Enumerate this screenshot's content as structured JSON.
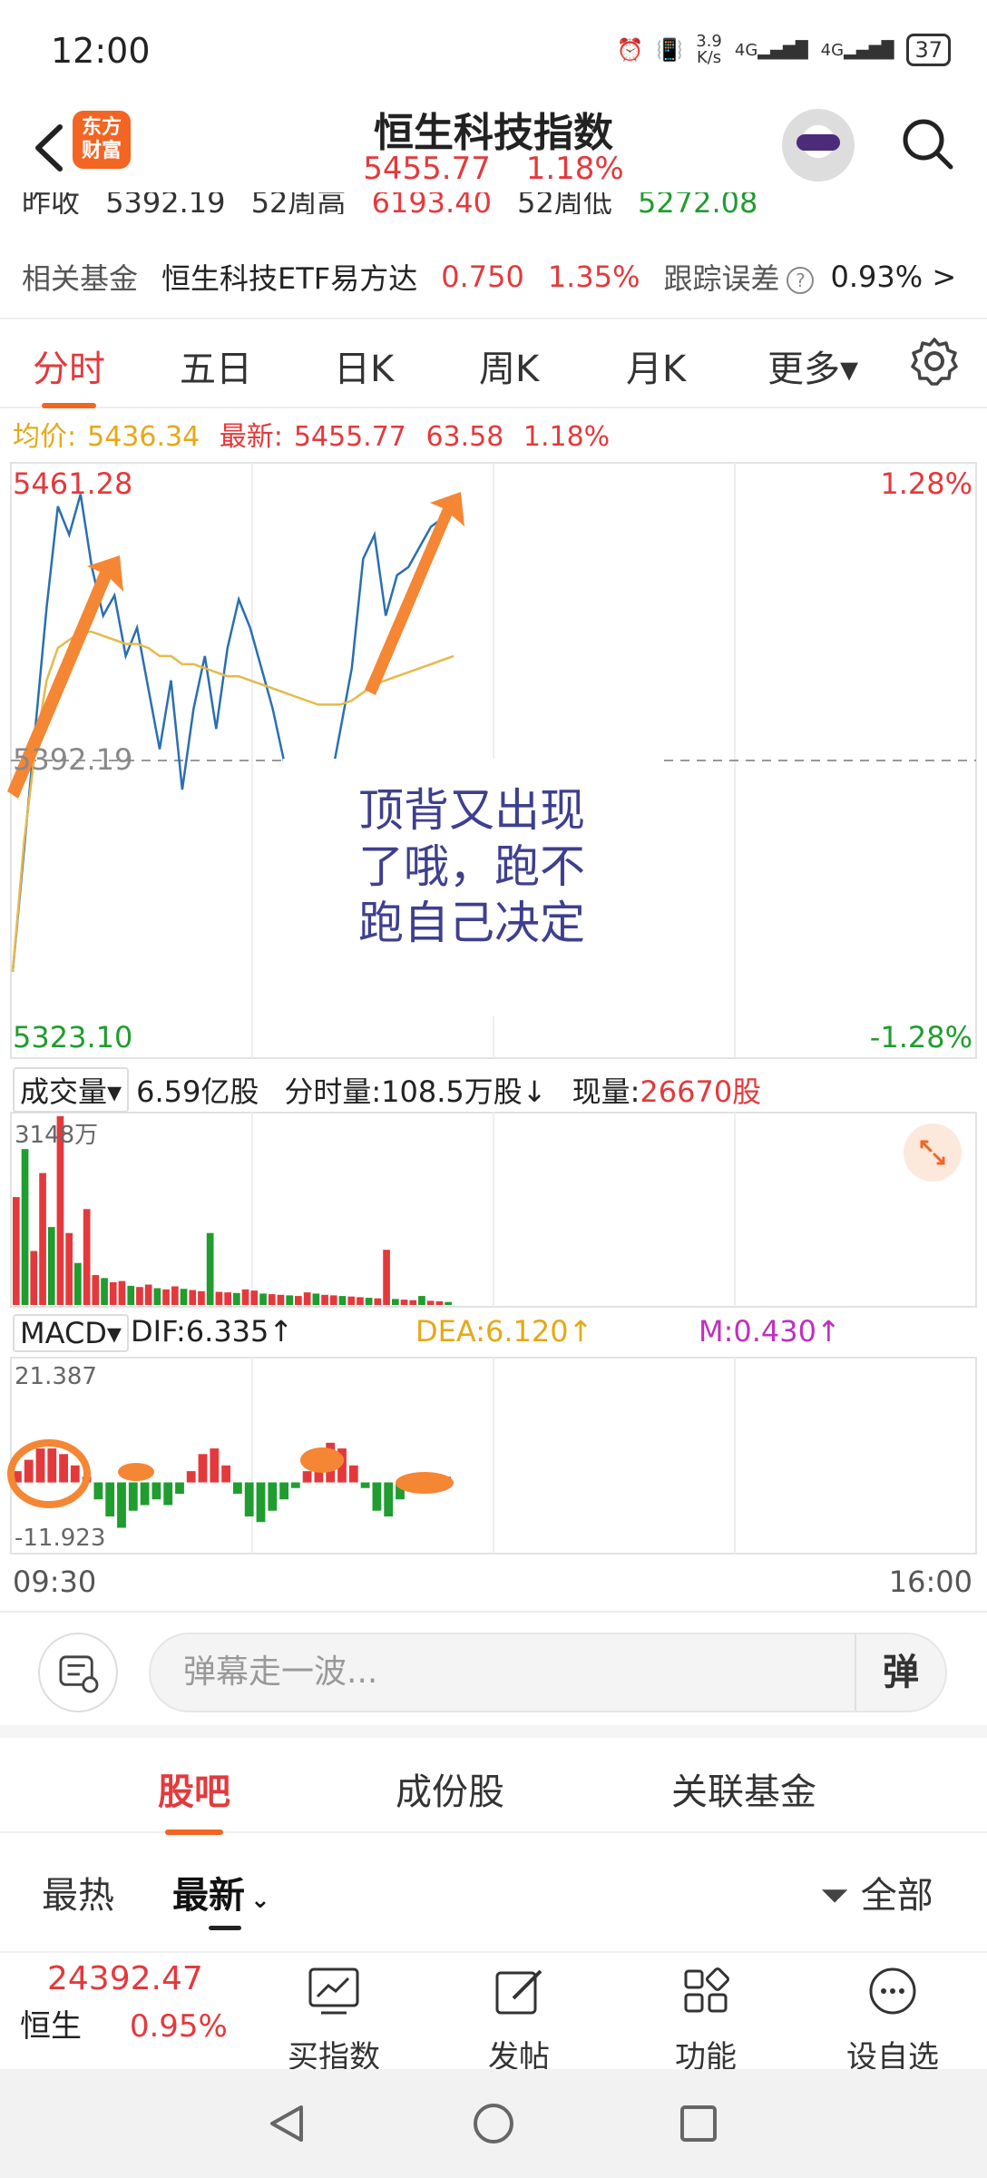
{
  "status_bar": {
    "time": "12:00",
    "net_speed": "3.9\nK/s",
    "net_speed_top": "3.9",
    "net_speed_bottom": "K/s",
    "signal1": "4G",
    "signal2": "4G",
    "battery": "37"
  },
  "header": {
    "logo_line1": "东方",
    "logo_line2": "财富",
    "title": "恒生科技指数",
    "price": "5455.77",
    "change_pct": "1.18%"
  },
  "clipped_row": {
    "prev_close_label": "昨收",
    "prev_close": "5392.19",
    "high52_label": "52周高",
    "high52": "6193.40",
    "low52_label": "52周低",
    "low52": "5272.08"
  },
  "fund_row": {
    "label": "相关基金",
    "fund_name": "恒生科技ETF易方达",
    "fund_price": "0.750",
    "fund_pct": "1.35%",
    "tracking_label": "跟踪误差",
    "tracking_value": "0.93%",
    "arrow": ">"
  },
  "tabs": [
    {
      "label": "分时"
    },
    {
      "label": "五日"
    },
    {
      "label": "日K"
    },
    {
      "label": "周K"
    },
    {
      "label": "月K"
    },
    {
      "label": "更多▾"
    }
  ],
  "avg_row": {
    "avg_label": "均价:",
    "avg_value": "5436.34",
    "latest_label": "最新:",
    "latest_value": "5455.77",
    "change": "63.58",
    "change_pct": "1.18%"
  },
  "chart_axis": {
    "top_price": "5461.28",
    "top_pct": "1.28%",
    "mid_price": "5392.19",
    "bottom_price": "5323.10",
    "bottom_pct": "-1.28%"
  },
  "annotation": {
    "line1": "顶背又出现",
    "line2": "了哦，跑不",
    "line3": "跑自己决定"
  },
  "volume_row": {
    "dropdown": "成交量▾",
    "total": "6.59亿股",
    "minute_label": "分时量:",
    "minute_value": "108.5万股↓",
    "now_label": "现量:",
    "now_value": "26670股",
    "max_label": "3148万"
  },
  "macd_row": {
    "dropdown": "MACD▾",
    "dif": "DIF:6.335↑",
    "dea": "DEA:6.120↑",
    "m": "M:0.430↑",
    "top": "21.387",
    "bottom": "-11.923"
  },
  "time_axis": {
    "start": "09:30",
    "end": "16:00"
  },
  "comment_bar": {
    "placeholder": "弹幕走一波...",
    "send": "弹"
  },
  "forum_tabs": [
    {
      "label": "股吧"
    },
    {
      "label": "成份股"
    },
    {
      "label": "关联基金"
    }
  ],
  "sort_row": {
    "hot": "最热",
    "latest": "最新",
    "filter": "全部"
  },
  "bottom_nav": {
    "index_value": "24392.47",
    "index_name": "恒生",
    "index_pct": "0.95%",
    "items": [
      {
        "label": "买指数"
      },
      {
        "label": "发帖"
      },
      {
        "label": "功能"
      },
      {
        "label": "设自选"
      }
    ]
  },
  "chart_data": [
    {
      "type": "line",
      "title": "",
      "xlabel": "",
      "ylabel": "",
      "x_range": [
        "09:30",
        "16:00"
      ],
      "ylim": [
        5323.1,
        5461.28
      ],
      "reference_line": 5392.19,
      "series": [
        {
          "values": [
            5340,
            5370,
            5400,
            5430,
            5455,
            5448,
            5458,
            5440,
            5428,
            5433,
            5418,
            5425,
            5410,
            5395,
            5412,
            5385,
            5405,
            5418,
            5400,
            5420,
            5432,
            5425,
            5415,
            5405,
            5392,
            5385,
            5380,
            5370,
            5385,
            5400,
            5415,
            5442,
            5448,
            5428,
            5438,
            5440,
            5445,
            5450,
            5452,
            5455
          ]
        },
        {
          "values": [
            5340,
            5372,
            5395,
            5412,
            5420,
            5422,
            5424,
            5424,
            5423,
            5422,
            5421,
            5421,
            5420,
            5418,
            5418,
            5416,
            5416,
            5415,
            5414,
            5413,
            5413,
            5412,
            5411,
            5410,
            5409,
            5408,
            5407,
            5406,
            5406,
            5406,
            5407,
            5409,
            5411,
            5412,
            5413,
            5414,
            5415,
            5416,
            5417,
            5418
          ]
        }
      ]
    },
    {
      "type": "bar",
      "title": "",
      "ylim": [
        0,
        3148
      ],
      "values": [
        1800,
        2600,
        900,
        2200,
        1300,
        3148,
        1200,
        700,
        1600,
        500,
        450,
        380,
        400,
        320,
        300,
        340,
        280,
        260,
        310,
        270,
        250,
        230,
        1200,
        220,
        210,
        200,
        260,
        240,
        190,
        180,
        170,
        160,
        150,
        210,
        190,
        170,
        160,
        150,
        140,
        130,
        120,
        110,
        920,
        100,
        90,
        80,
        150,
        70,
        60,
        50
      ]
    },
    {
      "type": "bar",
      "title": "",
      "ylim": [
        -11.923,
        21.387
      ],
      "values": [
        2,
        4,
        6,
        6,
        5,
        3,
        1,
        -3,
        -6,
        -8,
        -5,
        -4,
        -3,
        -4,
        -2,
        2,
        5,
        6,
        3,
        -2,
        -6,
        -7,
        -5,
        -3,
        -1,
        2,
        5,
        7,
        6,
        3,
        -1,
        -5,
        -6,
        -3,
        -1,
        1,
        1,
        1
      ]
    }
  ]
}
